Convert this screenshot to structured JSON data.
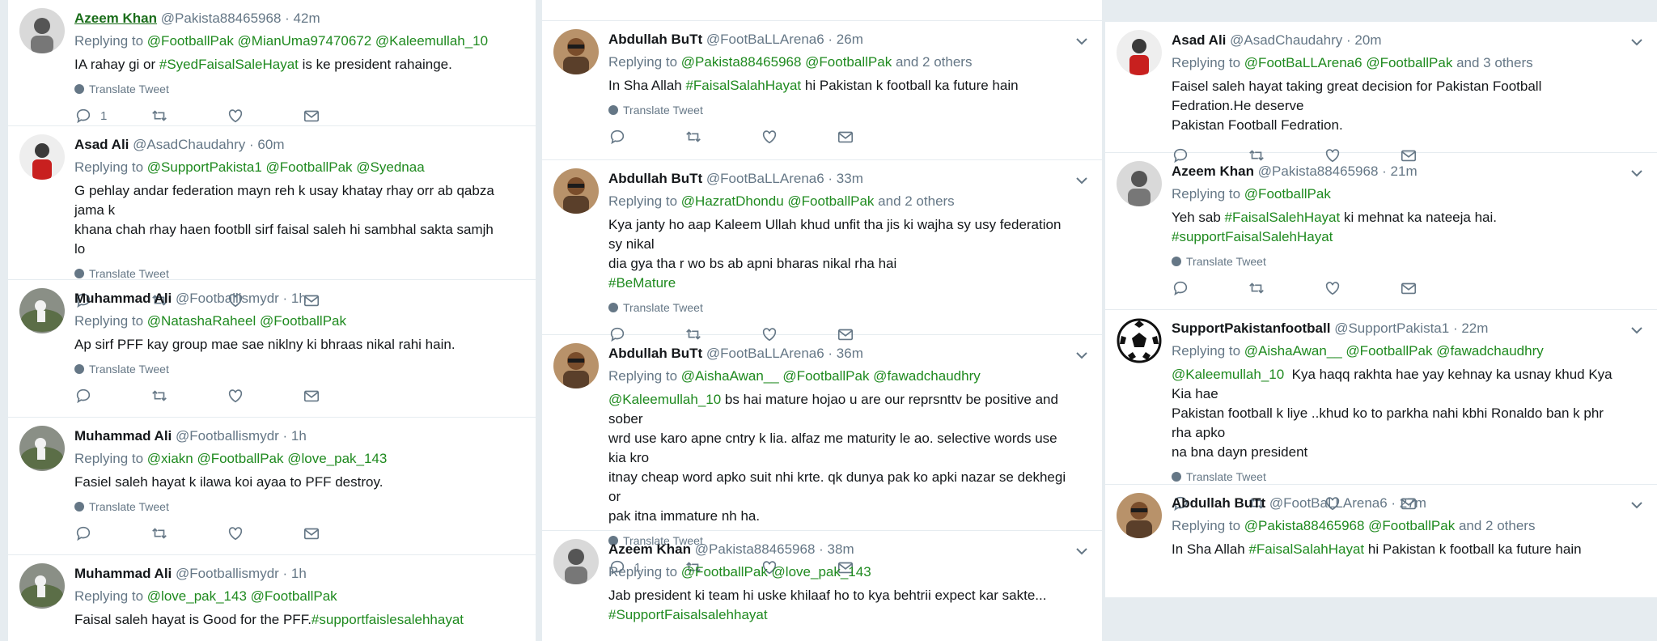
{
  "ui": {
    "translate_label": "Translate Tweet"
  },
  "col1": [
    {
      "name": "Azeem Khan",
      "handle": "@Pakista88465968",
      "time": "· 42m",
      "replying_prefix": "Replying to",
      "replying": "@FootballPak @MianUma97470672 @Kaleemullah_10",
      "text_parts": [
        "IA rahay gi or ",
        "#SyedFaisalSaleHayat",
        " is ke president rahainge."
      ],
      "reply_count": "1"
    },
    {
      "name": "Asad Ali",
      "handle": "@AsadChaudahry",
      "time": "· 60m",
      "replying_prefix": "Replying to",
      "replying": "@SupportPakista1 @FootballPak @Syednaa",
      "text": "G pehlay andar federation mayn reh k usay khatay rhay orr ab qabza jama k\nkhana chah rhay haen footbll sirf faisal saleh hi sambhal sakta samjh lo"
    },
    {
      "name": "Muhammad Ali",
      "handle": "@Footballismydr",
      "time": "· 1h",
      "replying_prefix": "Replying to",
      "replying": "@NatashaRaheel @FootballPak",
      "text": "Ap sirf PFF kay group mae sae niklny ki bhraas nikal rahi hain."
    },
    {
      "name": "Muhammad Ali",
      "handle": "@Footballismydr",
      "time": "· 1h",
      "replying_prefix": "Replying to",
      "replying": "@xiakn @FootballPak @love_pak_143",
      "text": "Fasiel saleh hayat k ilawa koi ayaa to PFF destroy."
    },
    {
      "name": "Muhammad Ali",
      "handle": "@Footballismydr",
      "time": "· 1h",
      "replying_prefix": "Replying to",
      "replying": "@love_pak_143 @FootballPak",
      "text_parts": [
        "Faisal saleh hayat is Good for the PFF.",
        "#supportfaislesalehhayat"
      ]
    }
  ],
  "col2": [
    {
      "name": "Abdullah BuTt",
      "handle": "@FootBaLLArena6",
      "time": "· 26m",
      "replying_prefix": "Replying to",
      "replying": "@Pakista88465968 @FootballPak",
      "replying_suffix": "and 2 others",
      "text_parts": [
        "In Sha Allah ",
        "#FaisalSalahHayat",
        " hi Pakistan k football ka future hain"
      ]
    },
    {
      "name": "Abdullah BuTt",
      "handle": "@FootBaLLArena6",
      "time": "· 33m",
      "replying_prefix": "Replying to",
      "replying": "@HazratDhondu @FootballPak",
      "replying_suffix": "and 2 others",
      "text": "Kya janty ho aap Kaleem Ullah khud unfit tha jis ki wajha sy usy federation sy nikal\ndia gya tha r wo bs ab apni bharas nikal rha hai",
      "hashtag": "#BeMature"
    },
    {
      "name": "Abdullah BuTt",
      "handle": "@FootBaLLArena6",
      "time": "· 36m",
      "replying_prefix": "Replying to",
      "replying": "@AishaAwan__ @FootballPak @fawadchaudhry",
      "mention": "@Kaleemullah_10",
      "text": " bs hai mature hojao u are our reprsnttv be positive and sober\nwrd use karo apne cntry k lia. alfaz me maturity le ao. selective words use kia kro\nitnay cheap word apko suit nhi krte. qk dunya pak ko apki nazar se dekhegi or\npak itna immature nh ha.",
      "reply_count": "1"
    },
    {
      "name": "Azeem Khan",
      "handle": "@Pakista88465968",
      "time": "· 38m",
      "replying_prefix": "Replying to",
      "replying": "@FootballPak @love_pak_143",
      "text": "Jab president ki team hi uske khilaaf ho to kya behtrii expect kar sakte...",
      "hashtag": "#SupportFaisalsalehhayat"
    }
  ],
  "col3": [
    {
      "name": "Asad Ali",
      "handle": "@AsadChaudahry",
      "time": "· 20m",
      "replying_prefix": "Replying to",
      "replying": "@FootBaLLArena6 @FootballPak",
      "replying_suffix": "and 3 others",
      "text": "Faisel saleh hayat taking great decision for Pakistan Football Fedration.He deserve\nPakistan Football Fedration."
    },
    {
      "name": "Azeem Khan",
      "handle": "@Pakista88465968",
      "time": "· 21m",
      "replying_prefix": "Replying to",
      "replying": "@FootballPak",
      "text_parts": [
        "Yeh sab ",
        "#FaisalSalehHayat",
        " ki mehnat ka nateeja hai."
      ],
      "hashtag": "#supportFaisalSalehHayat"
    },
    {
      "name": "SupportPakistanfootball",
      "handle": "@SupportPakista1",
      "time": "· 22m",
      "replying_prefix": "Replying to",
      "replying": "@AishaAwan__ @FootballPak @fawadchaudhry",
      "mention": "@Kaleemullah_10",
      "text": "  Kya haqq rakhta hae yay kehnay ka usnay khud Kya Kia hae\nPakistan football k liye ..khud ko to parkha nahi kbhi Ronaldo ban k phr rha apko\nna bna dayn president"
    },
    {
      "name": "Abdullah BuTt",
      "handle": "@FootBaLLArena6",
      "time": "· 27m",
      "replying_prefix": "Replying to",
      "replying": "@Pakista88465968 @FootballPak",
      "replying_suffix": "and 2 others",
      "text_parts": [
        "In Sha Allah ",
        "#FaisalSalahHayat",
        " hi Pakistan k football ka future hain"
      ]
    }
  ]
}
